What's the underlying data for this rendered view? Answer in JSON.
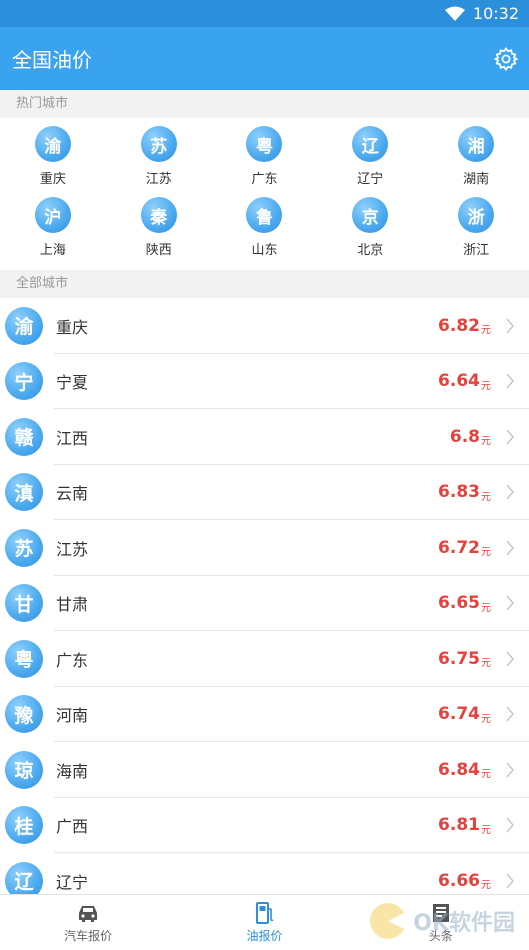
{
  "status_bar": {
    "time": "10:32"
  },
  "app_bar": {
    "title": "全国油价",
    "settings_icon": "gear-icon"
  },
  "hot_section": {
    "title": "热门城市",
    "cities": [
      {
        "glyph": "渝",
        "name": "重庆"
      },
      {
        "glyph": "苏",
        "name": "江苏"
      },
      {
        "glyph": "粤",
        "name": "广东"
      },
      {
        "glyph": "辽",
        "name": "辽宁"
      },
      {
        "glyph": "湘",
        "name": "湖南"
      },
      {
        "glyph": "沪",
        "name": "上海"
      },
      {
        "glyph": "秦",
        "name": "陕西"
      },
      {
        "glyph": "鲁",
        "name": "山东"
      },
      {
        "glyph": "京",
        "name": "北京"
      },
      {
        "glyph": "浙",
        "name": "浙江"
      }
    ]
  },
  "all_section": {
    "title": "全部城市",
    "unit": "元",
    "rows": [
      {
        "glyph": "渝",
        "name": "重庆",
        "price": "6.82"
      },
      {
        "glyph": "宁",
        "name": "宁夏",
        "price": "6.64"
      },
      {
        "glyph": "赣",
        "name": "江西",
        "price": "6.8"
      },
      {
        "glyph": "滇",
        "name": "云南",
        "price": "6.83"
      },
      {
        "glyph": "苏",
        "name": "江苏",
        "price": "6.72"
      },
      {
        "glyph": "甘",
        "name": "甘肃",
        "price": "6.65"
      },
      {
        "glyph": "粤",
        "name": "广东",
        "price": "6.75"
      },
      {
        "glyph": "豫",
        "name": "河南",
        "price": "6.74"
      },
      {
        "glyph": "琼",
        "name": "海南",
        "price": "6.84"
      },
      {
        "glyph": "桂",
        "name": "广西",
        "price": "6.81"
      },
      {
        "glyph": "辽",
        "name": "辽宁",
        "price": "6.66"
      }
    ]
  },
  "bottom_nav": [
    {
      "label": "汽车报价",
      "icon": "car-icon",
      "active": false
    },
    {
      "label": "油报价",
      "icon": "fuel-pump-icon",
      "active": true
    },
    {
      "label": "头条",
      "icon": "news-icon",
      "active": false
    }
  ],
  "watermark": {
    "text": "OK软件园"
  },
  "colors": {
    "primary": "#3aa3f0",
    "status_bar": "#2b8fdc",
    "price": "#e5413d"
  }
}
